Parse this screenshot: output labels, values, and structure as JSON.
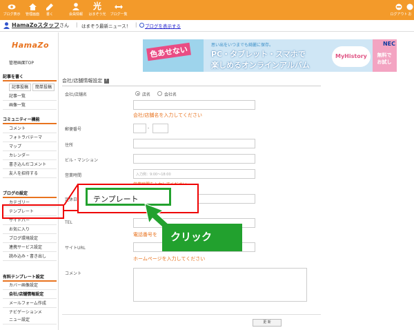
{
  "colors": {
    "accent": "#f39a2a",
    "highlight_red": "#e00000",
    "callout_green": "#22a12e",
    "link_blue": "#2222cc"
  },
  "topnav": {
    "items": [
      {
        "icon": "eye-icon",
        "label": "ブログ表示"
      },
      {
        "icon": "home-icon",
        "label": "管理画面"
      },
      {
        "icon": "pencil-icon",
        "label": "書く"
      },
      {
        "icon": "person-icon",
        "label": "会員情報"
      },
      {
        "icon": "kanji-icon",
        "label": "はまぞう光"
      },
      {
        "icon": "arrows-icon",
        "label": "ブログ一覧"
      },
      {
        "icon": "power-icon",
        "label": "ログアウト"
      },
      {
        "icon": "help-icon",
        "label": "お"
      }
    ],
    "kanji_glyph": "光"
  },
  "userbar": {
    "username": "HamaZoスタッフ",
    "honorific": "さん",
    "separator": "|",
    "news": "はまぞう最新ニュース！",
    "view_blog": "ブログを表示する"
  },
  "sidebar": {
    "logo": "HamaZo",
    "top_link": "管理画面TOP",
    "sections": [
      {
        "title": "記事を書く"
      },
      {
        "title": "コミュニティー機能"
      },
      {
        "title": "ブログの設定"
      },
      {
        "title": "有料テンプレート設定"
      }
    ],
    "write_buttons": [
      "記事投稿",
      "簡単投稿"
    ],
    "write_items": [
      "記事一覧",
      "画像一覧"
    ],
    "community_items": [
      "コメント",
      "フォトラバテーマ",
      "マップ",
      "カレンダー",
      "書き込んだコメント",
      "友人を招待する"
    ],
    "settings_items": [
      "カテゴリー",
      "テンプレート",
      "サイドバー",
      "お気に入り",
      "ブログ環境設定",
      "連携サービス設定",
      "読み込み・書き出し"
    ],
    "paid_items": [
      "カバー画像設定",
      "会社/店舗情報設定",
      "メールフォーム作成",
      "ナビゲーションメ",
      "ニュー設定"
    ]
  },
  "banner": {
    "tag": "色あせない",
    "line1": "思い出をいつまでも綺麗に保存。",
    "line2": "PC・タブレット・スマホで",
    "line3": "楽しめるオンラインアルバム",
    "brand": "MyHistory",
    "maker": "NEC",
    "free": "無料で お試し"
  },
  "form": {
    "title": "会社/店舗情報設定",
    "help_glyph": "?",
    "name_label": "会社/店舗名",
    "radio_options": [
      "店名",
      "会社名"
    ],
    "name_hint": "会社/店舗名を入力してください",
    "postal_label": "郵便番号",
    "postal_dash": "-",
    "address_label": "住所",
    "building_label": "ビル・マンション",
    "hours_label": "営業時間",
    "hours_placeholder": "入力例：9:00〜18:00",
    "hours_hint": "営業時間を入力してください",
    "holiday_label": "定休日",
    "tel_label": "TEL",
    "tel_hint": "電話番号を",
    "site_label": "サイトURL",
    "site_hint": "ホームページを入力してください",
    "comment_label": "コメント",
    "update_button": "更 新"
  },
  "callout": {
    "popup_text": "テンプレート",
    "click_text": "クリック"
  }
}
